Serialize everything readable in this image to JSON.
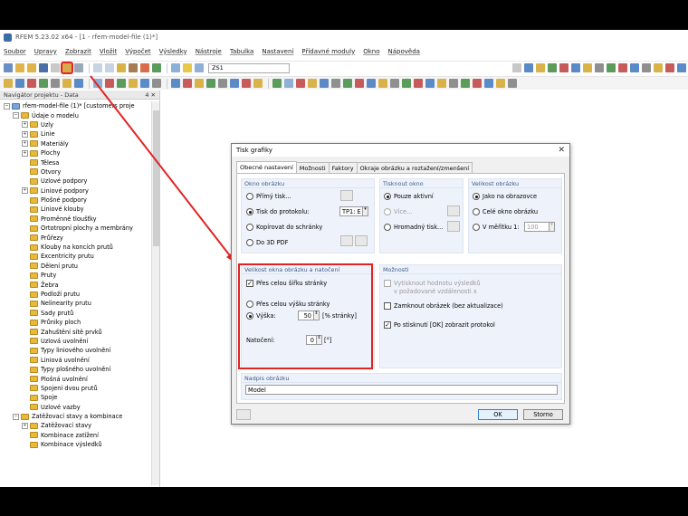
{
  "app": {
    "title": "RFEM 5.23.02 x64 - [1 - rfem-model-file (1)*]"
  },
  "menu": [
    "Soubor",
    "Upravy",
    "Zobrazit",
    "Vložit",
    "Výpočet",
    "Výsledky",
    "Nástroje",
    "Tabulka",
    "Nastavení",
    "Přídavné moduly",
    "Okno",
    "Nápověda"
  ],
  "toolbar": {
    "load_combo": "ZS1"
  },
  "navigator": {
    "title": "Navigátor projektu - Data",
    "pin": "4 ✕",
    "items": [
      {
        "label": "rfem-model-file (1)* [customers proje",
        "level": 0,
        "toggle": "−"
      },
      {
        "label": "Údaje o modelu",
        "level": 1,
        "toggle": "−"
      },
      {
        "label": "Uzly",
        "level": 2,
        "toggle": "+"
      },
      {
        "label": "Linie",
        "level": 2,
        "toggle": "+"
      },
      {
        "label": "Materiály",
        "level": 2,
        "toggle": "+"
      },
      {
        "label": "Plochy",
        "level": 2,
        "toggle": "+"
      },
      {
        "label": "Tělesa",
        "level": 2,
        "toggle": ""
      },
      {
        "label": "Otvory",
        "level": 2,
        "toggle": ""
      },
      {
        "label": "Uzlové podpory",
        "level": 2,
        "toggle": ""
      },
      {
        "label": "Liniové podpory",
        "level": 2,
        "toggle": "+"
      },
      {
        "label": "Plošné podpory",
        "level": 2,
        "toggle": ""
      },
      {
        "label": "Liniové klouby",
        "level": 2,
        "toggle": ""
      },
      {
        "label": "Proměnné tloušťky",
        "level": 2,
        "toggle": ""
      },
      {
        "label": "Ortotropní plochy a membrány",
        "level": 2,
        "toggle": ""
      },
      {
        "label": "Průřezy",
        "level": 2,
        "toggle": ""
      },
      {
        "label": "Klouby na koncích prutů",
        "level": 2,
        "toggle": ""
      },
      {
        "label": "Excentricity prutu",
        "level": 2,
        "toggle": ""
      },
      {
        "label": "Dělení prutu",
        "level": 2,
        "toggle": ""
      },
      {
        "label": "Pruty",
        "level": 2,
        "toggle": ""
      },
      {
        "label": "Žebra",
        "level": 2,
        "toggle": ""
      },
      {
        "label": "Podloží prutu",
        "level": 2,
        "toggle": ""
      },
      {
        "label": "Nelinearity prutu",
        "level": 2,
        "toggle": ""
      },
      {
        "label": "Sady prutů",
        "level": 2,
        "toggle": ""
      },
      {
        "label": "Průniky ploch",
        "level": 2,
        "toggle": ""
      },
      {
        "label": "Zahuštění sítě prvků",
        "level": 2,
        "toggle": ""
      },
      {
        "label": "Uzlová uvolnění",
        "level": 2,
        "toggle": ""
      },
      {
        "label": "Typy liniového uvolnění",
        "level": 2,
        "toggle": ""
      },
      {
        "label": "Liniová uvolnění",
        "level": 2,
        "toggle": ""
      },
      {
        "label": "Typy plošného uvolnění",
        "level": 2,
        "toggle": ""
      },
      {
        "label": "Plošná uvolnění",
        "level": 2,
        "toggle": ""
      },
      {
        "label": "Spojení dvou prutů",
        "level": 2,
        "toggle": ""
      },
      {
        "label": "Spoje",
        "level": 2,
        "toggle": ""
      },
      {
        "label": "Uzlové vazby",
        "level": 2,
        "toggle": ""
      },
      {
        "label": "Zatěžovací stavy a kombinace",
        "level": 1,
        "toggle": "−"
      },
      {
        "label": "Zatěžovací stavy",
        "level": 2,
        "toggle": "+"
      },
      {
        "label": "Kombinace zatížení",
        "level": 2,
        "toggle": ""
      },
      {
        "label": "Kombinace výsledků",
        "level": 2,
        "toggle": ""
      }
    ]
  },
  "dialog": {
    "title": "Tisk grafiky",
    "close": "✕",
    "tabs": [
      "Obecné nastavení",
      "Možnosti",
      "Faktory",
      "Okraje obrázku a roztažení/zmenšení"
    ],
    "okno": {
      "title": "Okno obrázku",
      "opts": [
        "Přímý tisk...",
        "Tisk do protokolu:",
        "Kopírovat do schránky",
        "Do 3D PDF"
      ],
      "protocol": "TP1: E"
    },
    "tisk": {
      "title": "Tisknout okno",
      "opts": [
        "Pouze aktivní",
        "Více...",
        "Hromadný tisk..."
      ]
    },
    "velikost": {
      "title": "Velikost obrázku",
      "opts": [
        "Jako na obrazovce",
        "Celé okno obrázku",
        "V měřítku 1:"
      ],
      "scale": "100"
    },
    "natoceni": {
      "title": "Velikost okna obrázku a natočení",
      "full_width": "Přes celou šířku stránky",
      "full_height": "Přes celou výšku stránky",
      "height_label": "Výška:",
      "height_value": "50",
      "height_unit": "[% stránky]",
      "rot_label": "Natočení:",
      "rot_value": "0",
      "rot_unit": "[°]"
    },
    "moznosti": {
      "title": "Možnosti",
      "opt1a": "Vytisknout hodnotu výsledků",
      "opt1b": "v požadované vzdálenosti x",
      "opt2": "Zamknout obrázek (bez aktualizace)",
      "opt3": "Po stisknutí [OK] zobrazit protokol"
    },
    "nadpis": {
      "title": "Nadpis obrázku",
      "value": "Model"
    },
    "ok": "OK",
    "cancel": "Storno"
  },
  "colors": {
    "highlight": "#e02424",
    "group_title": "#3c5a8a"
  }
}
